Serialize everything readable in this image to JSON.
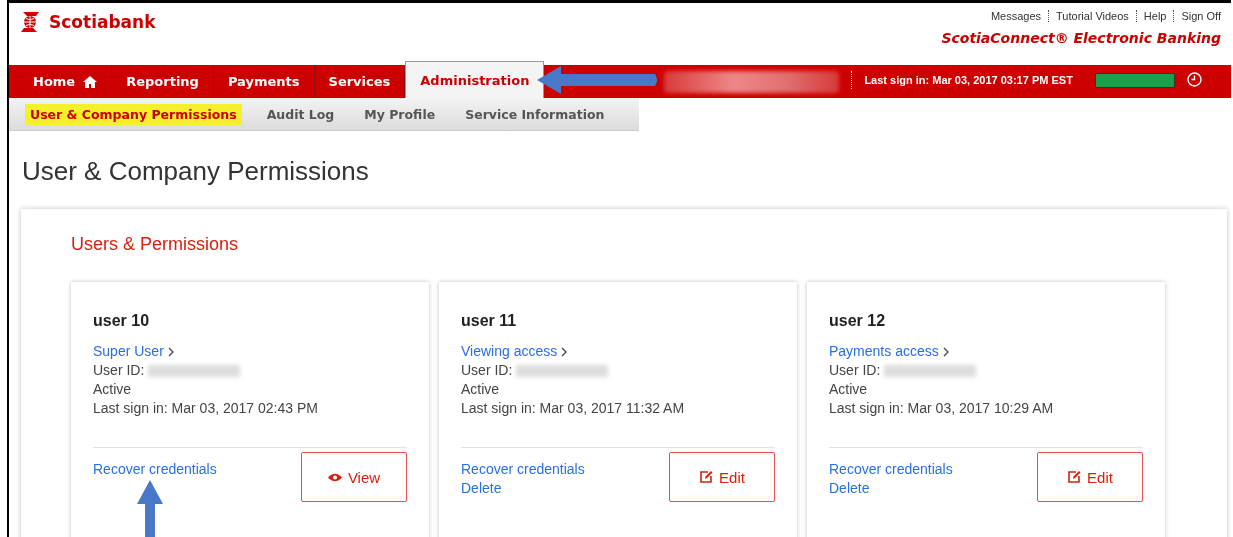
{
  "header": {
    "brand": "Scotiabank",
    "utility_links": [
      "Messages",
      "Tutorial Videos",
      "Help",
      "Sign Off"
    ],
    "product": "ScotiaConnect® Electronic Banking"
  },
  "main_nav": [
    {
      "label": "Home",
      "kind": "with-icon",
      "selected": false
    },
    {
      "label": "Reporting",
      "kind": "text",
      "selected": false
    },
    {
      "label": "Payments",
      "kind": "text",
      "selected": false
    },
    {
      "label": "Services",
      "kind": "text",
      "selected": false
    },
    {
      "label": "Administration",
      "kind": "text",
      "selected": true
    }
  ],
  "status": {
    "last_sign_in": "Last sign in: Mar 03, 2017 03:17 PM EST",
    "session_meter": {
      "level": 1
    }
  },
  "sub_nav": [
    {
      "label": "User & Company Permissions",
      "selected": true
    },
    {
      "label": "Audit Log",
      "selected": false
    },
    {
      "label": "My Profile",
      "selected": false
    },
    {
      "label": "Service Information",
      "selected": false
    }
  ],
  "page_title": "User & Company Permissions",
  "section_title": "Users & Permissions",
  "users": [
    {
      "name": "user 10",
      "role": "Super User",
      "user_id_label": "User ID:",
      "status": "Active",
      "last_sign_in": "Last sign in: Mar 03, 2017 02:43 PM",
      "links": [
        "Recover credentials"
      ],
      "action": {
        "kind": "view",
        "label": "View"
      }
    },
    {
      "name": "user 11",
      "role": "Viewing access",
      "user_id_label": "User ID:",
      "status": "Active",
      "last_sign_in": "Last sign in: Mar 03, 2017 11:32 AM",
      "links": [
        "Recover credentials",
        "Delete"
      ],
      "action": {
        "kind": "edit",
        "label": "Edit"
      }
    },
    {
      "name": "user 12",
      "role": "Payments access",
      "user_id_label": "User ID:",
      "status": "Active",
      "last_sign_in": "Last sign in: Mar 03, 2017 10:29 AM",
      "links": [
        "Recover credentials",
        "Delete"
      ],
      "action": {
        "kind": "edit",
        "label": "Edit"
      }
    }
  ]
}
